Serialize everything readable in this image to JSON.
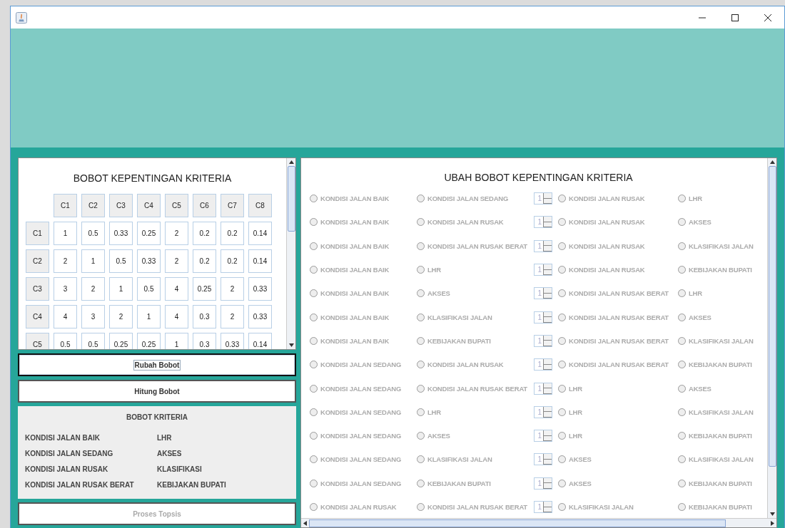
{
  "matrix": {
    "title": "BOBOT KEPENTINGAN KRITERIA",
    "columns": [
      "C1",
      "C2",
      "C3",
      "C4",
      "C5",
      "C6",
      "C7",
      "C8"
    ],
    "rows": [
      {
        "label": "C1",
        "values": [
          "1",
          "0.5",
          "0.33",
          "0.25",
          "2",
          "0.2",
          "0.2",
          "0.14"
        ]
      },
      {
        "label": "C2",
        "values": [
          "2",
          "1",
          "0.5",
          "0.33",
          "2",
          "0.2",
          "0.2",
          "0.14"
        ]
      },
      {
        "label": "C3",
        "values": [
          "3",
          "2",
          "1",
          "0.5",
          "4",
          "0.25",
          "2",
          "0.33"
        ]
      },
      {
        "label": "C4",
        "values": [
          "4",
          "3",
          "2",
          "1",
          "4",
          "0.3",
          "2",
          "0.33"
        ]
      },
      {
        "label": "C5",
        "values": [
          "0.5",
          "0.5",
          "0.25",
          "0.25",
          "1",
          "0.3",
          "0.33",
          "0.14"
        ]
      }
    ]
  },
  "actions": [
    {
      "label": "Rubah Bobot",
      "focused": true,
      "disabled": false
    },
    {
      "label": "Hitung Bobot",
      "focused": false,
      "disabled": false
    }
  ],
  "weights": {
    "title": "BOBOT KRITERIA",
    "left": [
      "KONDISI JALAN BAIK",
      "KONDISI JALAN SEDANG",
      "KONDISI JALAN RUSAK",
      "KONDISI JALAN RUSAK BERAT"
    ],
    "right": [
      "LHR",
      "AKSES",
      "KLASIFIKASI",
      "KEBIJAKAN BUPATI"
    ]
  },
  "process_button": {
    "label": "Proses Topsis",
    "disabled": true
  },
  "comparison": {
    "title": "UBAH BOBOT KEPENTINGAN KRITERIA",
    "disabled": true,
    "rows": [
      {
        "a": {
          "label": "KONDISI JALAN BAIK",
          "selected": false
        },
        "b": {
          "label": "KONDISI JALAN SEDANG",
          "selected": false
        },
        "value": "1",
        "c": {
          "label": "KONDISI JALAN RUSAK",
          "selected": false
        },
        "d": {
          "label": "LHR",
          "selected": false
        }
      },
      {
        "a": {
          "label": "KONDISI JALAN BAIK",
          "selected": false
        },
        "b": {
          "label": "KONDISI JALAN RUSAK",
          "selected": false
        },
        "value": "1",
        "c": {
          "label": "KONDISI JALAN RUSAK",
          "selected": false
        },
        "d": {
          "label": "AKSES",
          "selected": false
        }
      },
      {
        "a": {
          "label": "KONDISI JALAN BAIK",
          "selected": false
        },
        "b": {
          "label": "KONDISI JALAN RUSAK BERAT",
          "selected": false
        },
        "value": "1",
        "c": {
          "label": "KONDISI JALAN RUSAK",
          "selected": false
        },
        "d": {
          "label": "KLASIFIKASI JALAN",
          "selected": false
        }
      },
      {
        "a": {
          "label": "KONDISI JALAN BAIK",
          "selected": false
        },
        "b": {
          "label": "LHR",
          "selected": false
        },
        "value": "1",
        "c": {
          "label": "KONDISI JALAN RUSAK",
          "selected": false
        },
        "d": {
          "label": "KEBIJAKAN BUPATI",
          "selected": false
        }
      },
      {
        "a": {
          "label": "KONDISI JALAN BAIK",
          "selected": false
        },
        "b": {
          "label": "AKSES",
          "selected": false
        },
        "value": "1",
        "c": {
          "label": "KONDISI JALAN RUSAK BERAT",
          "selected": false
        },
        "d": {
          "label": "LHR",
          "selected": false
        }
      },
      {
        "a": {
          "label": "KONDISI JALAN BAIK",
          "selected": false
        },
        "b": {
          "label": "KLASIFIKASI JALAN",
          "selected": false
        },
        "value": "1",
        "c": {
          "label": "KONDISI JALAN RUSAK BERAT",
          "selected": false
        },
        "d": {
          "label": "AKSES",
          "selected": false
        }
      },
      {
        "a": {
          "label": "KONDISI JALAN BAIK",
          "selected": false
        },
        "b": {
          "label": "KEBIJAKAN BUPATI",
          "selected": false
        },
        "value": "1",
        "c": {
          "label": "KONDISI JALAN RUSAK BERAT",
          "selected": false
        },
        "d": {
          "label": "KLASIFIKASI JALAN",
          "selected": false
        }
      },
      {
        "a": {
          "label": "KONDISI JALAN SEDANG",
          "selected": false
        },
        "b": {
          "label": "KONDISI JALAN RUSAK",
          "selected": false
        },
        "value": "1",
        "c": {
          "label": "KONDISI JALAN RUSAK BERAT",
          "selected": false
        },
        "d": {
          "label": "KEBIJAKAN BUPATI",
          "selected": false
        }
      },
      {
        "a": {
          "label": "KONDISI JALAN SEDANG",
          "selected": false
        },
        "b": {
          "label": "KONDISI JALAN RUSAK BERAT",
          "selected": false
        },
        "value": "1",
        "c": {
          "label": "LHR",
          "selected": false
        },
        "d": {
          "label": "AKSES",
          "selected": false
        }
      },
      {
        "a": {
          "label": "KONDISI JALAN SEDANG",
          "selected": false
        },
        "b": {
          "label": "LHR",
          "selected": false
        },
        "value": "1",
        "c": {
          "label": "LHR",
          "selected": false
        },
        "d": {
          "label": "KLASIFIKASI JALAN",
          "selected": false
        }
      },
      {
        "a": {
          "label": "KONDISI JALAN SEDANG",
          "selected": false
        },
        "b": {
          "label": "AKSES",
          "selected": false
        },
        "value": "1",
        "c": {
          "label": "LHR",
          "selected": false
        },
        "d": {
          "label": "KEBIJAKAN BUPATI",
          "selected": false
        }
      },
      {
        "a": {
          "label": "KONDISI JALAN SEDANG",
          "selected": false
        },
        "b": {
          "label": "KLASIFIKASI JALAN",
          "selected": false
        },
        "value": "1",
        "c": {
          "label": "AKSES",
          "selected": false
        },
        "d": {
          "label": "KLASIFIKASI JALAN",
          "selected": false
        }
      },
      {
        "a": {
          "label": "KONDISI JALAN SEDANG",
          "selected": false
        },
        "b": {
          "label": "KEBIJAKAN BUPATI",
          "selected": false
        },
        "value": "1",
        "c": {
          "label": "AKSES",
          "selected": false
        },
        "d": {
          "label": "KEBIJAKAN BUPATI",
          "selected": false
        }
      },
      {
        "a": {
          "label": "KONDISI JALAN RUSAK",
          "selected": false
        },
        "b": {
          "label": "KONDISI JALAN RUSAK BERAT",
          "selected": false
        },
        "value": "1",
        "c": {
          "label": "KLASIFIKASI JALAN",
          "selected": false
        },
        "d": {
          "label": "KEBIJAKAN BUPATI",
          "selected": false
        }
      }
    ]
  }
}
